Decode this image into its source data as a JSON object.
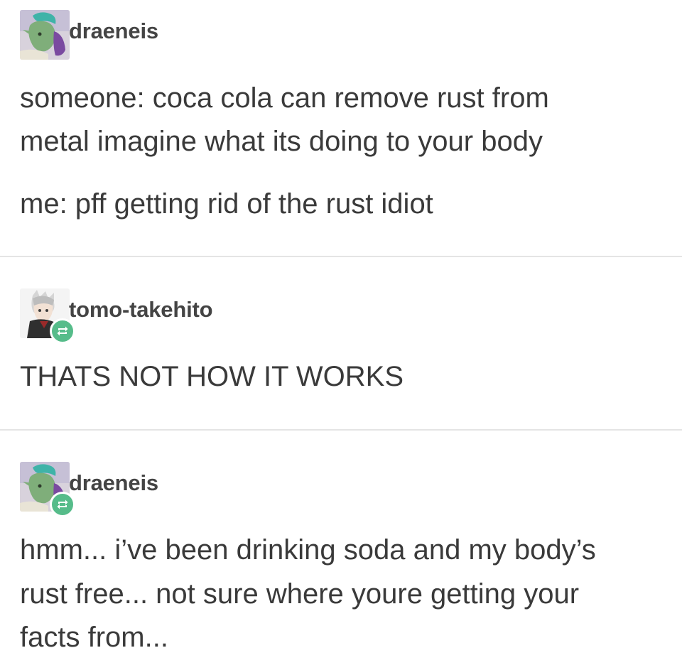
{
  "posts": [
    {
      "username": "draeneis",
      "reblog": false,
      "paragraphs": [
        "someone: coca cola can remove rust from",
        "metal imagine what its doing to your body",
        "me: pff getting rid of the rust idiot"
      ]
    },
    {
      "username": "tomo-takehito",
      "reblog": true,
      "paragraphs": [
        "THATS NOT HOW IT WORKS"
      ]
    },
    {
      "username": "draeneis",
      "reblog": true,
      "paragraphs": [
        "hmm... i’ve been drinking soda and my body’s",
        "rust free... not sure where youre getting your",
        "facts from..."
      ]
    }
  ],
  "icons": {
    "avatar_1": "avatar-image",
    "avatar_2": "avatar-image",
    "avatar_3": "avatar-image",
    "reblog": "reblog-icon"
  },
  "colors": {
    "reblog_badge": "#56bc8a",
    "divider": "#e4e4e4",
    "text": "#3a3a3a"
  }
}
